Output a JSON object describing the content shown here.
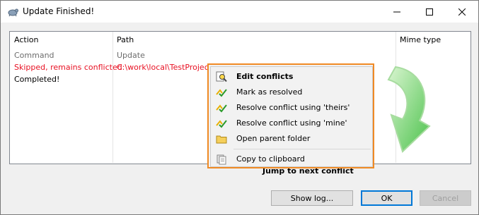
{
  "window": {
    "title": "Update Finished!",
    "icon": "tortoise-icon",
    "controls": {
      "minimize": "minimize-icon",
      "maximize": "maximize-icon",
      "close": "close-icon"
    }
  },
  "list": {
    "columns": {
      "action": "Action",
      "path": "Path",
      "mime": "Mime type"
    },
    "rows": [
      {
        "action": "Command",
        "path": "Update",
        "status": "header"
      },
      {
        "action": "Skipped, remains conflicted",
        "path": "C:\\work\\local\\TestProject1",
        "status": "conflicted"
      },
      {
        "action": "Completed!",
        "path": "",
        "status": "completed"
      }
    ]
  },
  "context_menu": {
    "items": [
      {
        "label": "Edit conflicts",
        "icon": "edit-conflicts-icon",
        "default": true
      },
      {
        "label": "Mark as resolved",
        "icon": "resolved-icon"
      },
      {
        "label": "Resolve conflict using 'theirs'",
        "icon": "resolved-icon"
      },
      {
        "label": "Resolve conflict using 'mine'",
        "icon": "resolved-icon"
      },
      {
        "label": "Open parent folder",
        "icon": "folder-icon"
      },
      {
        "label": "Copy to clipboard",
        "icon": "clipboard-icon"
      }
    ]
  },
  "footer": {
    "next_conflict": "Jump to next conflict",
    "buttons": {
      "show_log": "Show log...",
      "ok": "OK",
      "cancel": "Cancel"
    }
  },
  "colors": {
    "conflict_red": "#e81123",
    "highlight_orange": "#f08a24",
    "accent": "#0078d7",
    "arrow_green": "#4cc24c"
  }
}
